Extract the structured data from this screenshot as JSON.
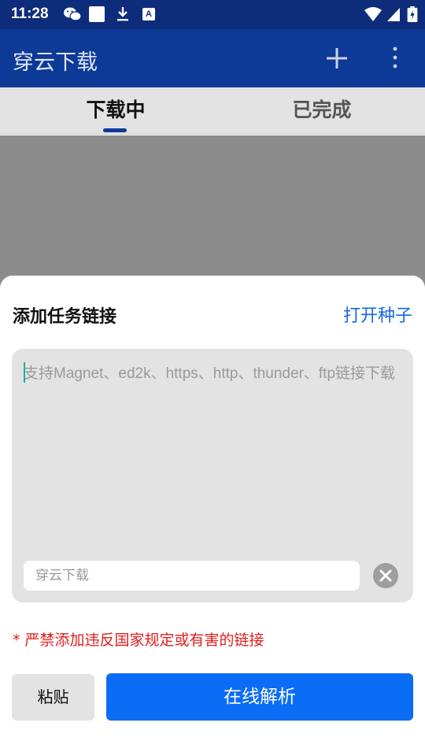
{
  "status_bar": {
    "time": "11:28",
    "a_badge": "A"
  },
  "app_bar": {
    "title": "穿云下载"
  },
  "tabs": [
    {
      "label": "下载中",
      "selected": true
    },
    {
      "label": "已完成",
      "selected": false
    }
  ],
  "sheet": {
    "title": "添加任务链接",
    "open_torrent": "打开种子",
    "url_placeholder": "支持Magnet、ed2k、https、http、thunder、ftp链接下载",
    "name_placeholder": "穿云下载",
    "warning": "* 严禁添加违反国家规定或有害的链接",
    "paste_label": "粘贴",
    "parse_label": "在线解析"
  },
  "colors": {
    "app_bar": "#0d3a96",
    "accent": "#1769e8",
    "primary_button": "#0b6cf5",
    "warning": "#e02020"
  }
}
